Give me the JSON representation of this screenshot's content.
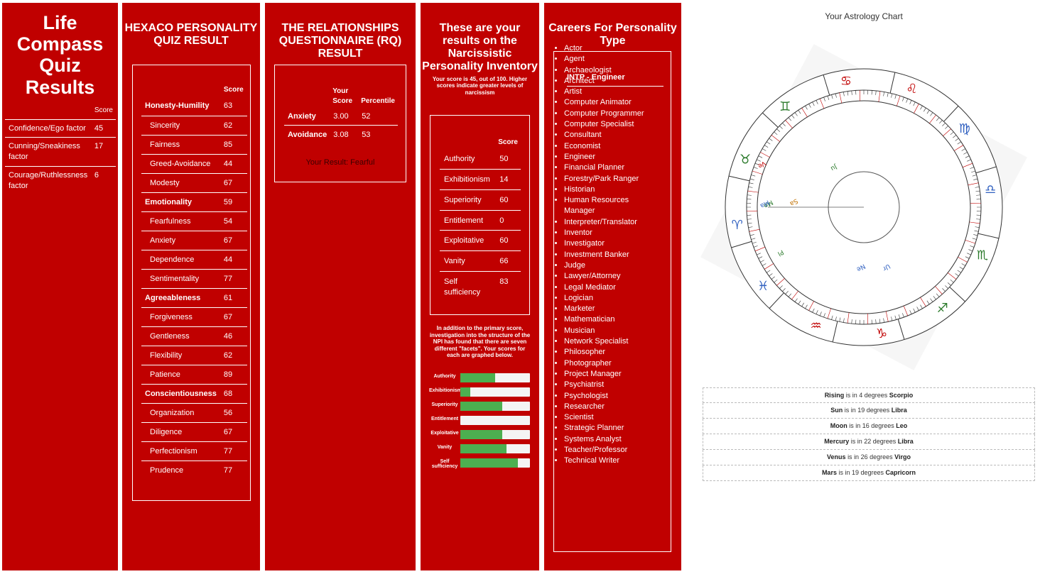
{
  "life_compass": {
    "title": "Life Compass Quiz Results",
    "score_header": "Score",
    "rows": [
      {
        "label": "Confidence/Ego factor",
        "score": "45"
      },
      {
        "label": "Cunning/Sneakiness factor",
        "score": "17"
      },
      {
        "label": "Courage/Ruthlessness factor",
        "score": "6"
      }
    ]
  },
  "hexaco": {
    "title": "HEXACO PERSONALITY QUIZ RESULT",
    "score_header": "Score",
    "rows": [
      {
        "label": "Honesty-Humility",
        "score": "63",
        "bold": true
      },
      {
        "label": "Sincerity",
        "score": "62"
      },
      {
        "label": "Fairness",
        "score": "85"
      },
      {
        "label": "Greed-Avoidance",
        "score": "44"
      },
      {
        "label": "Modesty",
        "score": "67"
      },
      {
        "label": "Emotionality",
        "score": "59",
        "bold": true
      },
      {
        "label": "Fearfulness",
        "score": "54"
      },
      {
        "label": "Anxiety",
        "score": "67"
      },
      {
        "label": "Dependence",
        "score": "44"
      },
      {
        "label": "Sentimentality",
        "score": "77"
      },
      {
        "label": "Agreeableness",
        "score": "61",
        "bold": true
      },
      {
        "label": "Forgiveness",
        "score": "67"
      },
      {
        "label": "Gentleness",
        "score": "46"
      },
      {
        "label": "Flexibility",
        "score": "62"
      },
      {
        "label": "Patience",
        "score": "89"
      },
      {
        "label": "Conscientiousness",
        "score": "68",
        "bold": true
      },
      {
        "label": "Organization",
        "score": "56"
      },
      {
        "label": "Diligence",
        "score": "67"
      },
      {
        "label": "Perfectionism",
        "score": "77"
      },
      {
        "label": "Prudence",
        "score": "77"
      }
    ]
  },
  "rq": {
    "title": "THE RELATIONSHIPS QUESTIONNAIRE (RQ) RESULT",
    "col_score": "Your Score",
    "col_percentile": "Percentile",
    "rows": [
      {
        "label": "Anxiety",
        "score": "3.00",
        "percentile": "52"
      },
      {
        "label": "Avoidance",
        "score": "3.08",
        "percentile": "53"
      }
    ],
    "result": "Your Result: Fearful"
  },
  "npi": {
    "title": "These are your results on the Narcissistic Personality Inventory",
    "note": "Your score is 45, out of 100. Higher scores indicate greater levels of narcissism",
    "score_header": "Score",
    "rows": [
      {
        "label": "Authority",
        "score": "50"
      },
      {
        "label": "Exhibitionism",
        "score": "14"
      },
      {
        "label": "Superiority",
        "score": "60"
      },
      {
        "label": "Entitlement",
        "score": "0"
      },
      {
        "label": "Exploitative",
        "score": "60"
      },
      {
        "label": "Vanity",
        "score": "66"
      },
      {
        "label": "Self sufficiency",
        "score": "83"
      }
    ],
    "facet_note": "In addition to the primary score, investigation into the structure of the NPI has found that there are seven different \"facets\". Your scores for each are graphed below.",
    "facets": [
      {
        "label": "Authority",
        "value": 0.5
      },
      {
        "label": "Exhibitionism",
        "value": 0.14
      },
      {
        "label": "Superiority",
        "value": 0.6
      },
      {
        "label": "Entitlement",
        "value": 0.0
      },
      {
        "label": "Exploitative",
        "value": 0.6
      },
      {
        "label": "Vanity",
        "value": 0.66
      },
      {
        "label": "Self sufficiency",
        "value": 0.83
      }
    ],
    "bar_color": "#4caf50"
  },
  "careers": {
    "title": "Careers For Personality Type",
    "type": "INTP - Engineer",
    "items": [
      "Actor",
      "Agent",
      "Archaeologist",
      "Architect",
      "Artist",
      "Computer Animator",
      "Computer Programmer",
      "Computer Specialist",
      "Consultant",
      "Economist",
      "Engineer",
      "Financial Planner",
      "Forestry/Park Ranger",
      "Historian",
      "Human Resources Manager",
      "Interpreter/Translator",
      "Inventor",
      "Investigator",
      "Investment Banker",
      "Judge",
      "Lawyer/Attorney",
      "Legal Mediator",
      "Logician",
      "Marketer",
      "Mathematician",
      "Musician",
      "Network Specialist",
      "Philosopher",
      "Photographer",
      "Project Manager",
      "Psychiatrist",
      "Psychologist",
      "Researcher",
      "Scientist",
      "Strategic Planner",
      "Systems Analyst",
      "Teacher/Professor",
      "Technical Writer"
    ]
  },
  "astrology": {
    "title": "Your Astrology Chart",
    "zodiac_glyphs": [
      "♌",
      "♋",
      "♊",
      "♉",
      "♈",
      "♓",
      "♒",
      "♑",
      "♐",
      "♏",
      "♎",
      "♍"
    ],
    "inner_labels": [
      "Mo",
      "Sa",
      "Ve",
      "Ma",
      "Ne",
      "Ur",
      "Pl",
      "Ju"
    ],
    "positions": [
      {
        "body": "Rising",
        "mid": "is in 4 degrees",
        "sign": "Scorpio"
      },
      {
        "body": "Sun",
        "mid": "is in 19 degrees",
        "sign": "Libra"
      },
      {
        "body": "Moon",
        "mid": "is in 16 degrees",
        "sign": "Leo"
      },
      {
        "body": "Mercury",
        "mid": "is in 22 degrees",
        "sign": "Libra"
      },
      {
        "body": "Venus",
        "mid": "is in 26 degrees",
        "sign": "Virgo"
      },
      {
        "body": "Mars",
        "mid": "is in 19 degrees",
        "sign": "Capricorn"
      }
    ]
  },
  "colors": {
    "panel_bg": "#c00000",
    "text": "#ffffff"
  }
}
